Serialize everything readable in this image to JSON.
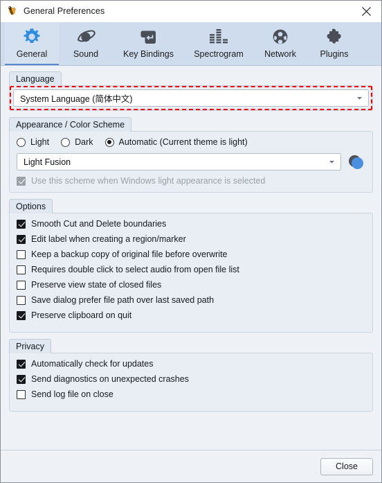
{
  "window": {
    "title": "General Preferences",
    "app_icon": "ocenaudio-icon",
    "close_icon": "close-icon"
  },
  "tabs": [
    {
      "label": "General",
      "icon": "gear-icon",
      "selected": true
    },
    {
      "label": "Sound",
      "icon": "speaker-icon",
      "selected": false
    },
    {
      "label": "Key Bindings",
      "icon": "enter-key-icon",
      "selected": false
    },
    {
      "label": "Spectrogram",
      "icon": "bar-levels-icon",
      "selected": false
    },
    {
      "label": "Network",
      "icon": "globe-icon",
      "selected": false
    },
    {
      "label": "Plugins",
      "icon": "puzzle-piece-icon",
      "selected": false
    }
  ],
  "language": {
    "group_title": "Language",
    "selected": "System Language (简体中文)",
    "highlighted": true,
    "highlight_color": "#ff0000",
    "dropdown_icon": "chevron-down-icon"
  },
  "appearance": {
    "group_title": "Appearance / Color Scheme",
    "theme_options": [
      {
        "label": "Light",
        "checked": false
      },
      {
        "label": "Dark",
        "checked": false
      },
      {
        "label": "Automatic (Current theme is light)",
        "checked": true
      }
    ],
    "scheme_selected": "Light Fusion",
    "dropdown_icon": "chevron-down-icon",
    "color_dot_back": "#4c4f54",
    "color_dot_front": "#4a90e2",
    "use_scheme": {
      "label": "Use this scheme when Windows light appearance is selected",
      "checked": true,
      "disabled": true
    }
  },
  "options": {
    "group_title": "Options",
    "items": [
      {
        "label": "Smooth Cut and Delete boundaries",
        "checked": true
      },
      {
        "label": "Edit label when creating a region/marker",
        "checked": true
      },
      {
        "label": "Keep a backup copy of original file before overwrite",
        "checked": false
      },
      {
        "label": "Requires double click to select audio from open file list",
        "checked": false
      },
      {
        "label": "Preserve view state of closed files",
        "checked": false
      },
      {
        "label": "Save dialog prefer file path over last saved path",
        "checked": false
      },
      {
        "label": "Preserve clipboard on quit",
        "checked": true
      }
    ]
  },
  "privacy": {
    "group_title": "Privacy",
    "items": [
      {
        "label": "Automatically check for updates",
        "checked": true
      },
      {
        "label": "Send diagnostics on unexpected crashes",
        "checked": true
      },
      {
        "label": "Send log file on close",
        "checked": false
      }
    ]
  },
  "footer": {
    "close_label": "Close"
  },
  "theme": {
    "tabbar_bg": "#cfdced",
    "content_bg": "#eef2f7",
    "group_bg": "#e9eef5",
    "accent": "#4a90e2"
  }
}
